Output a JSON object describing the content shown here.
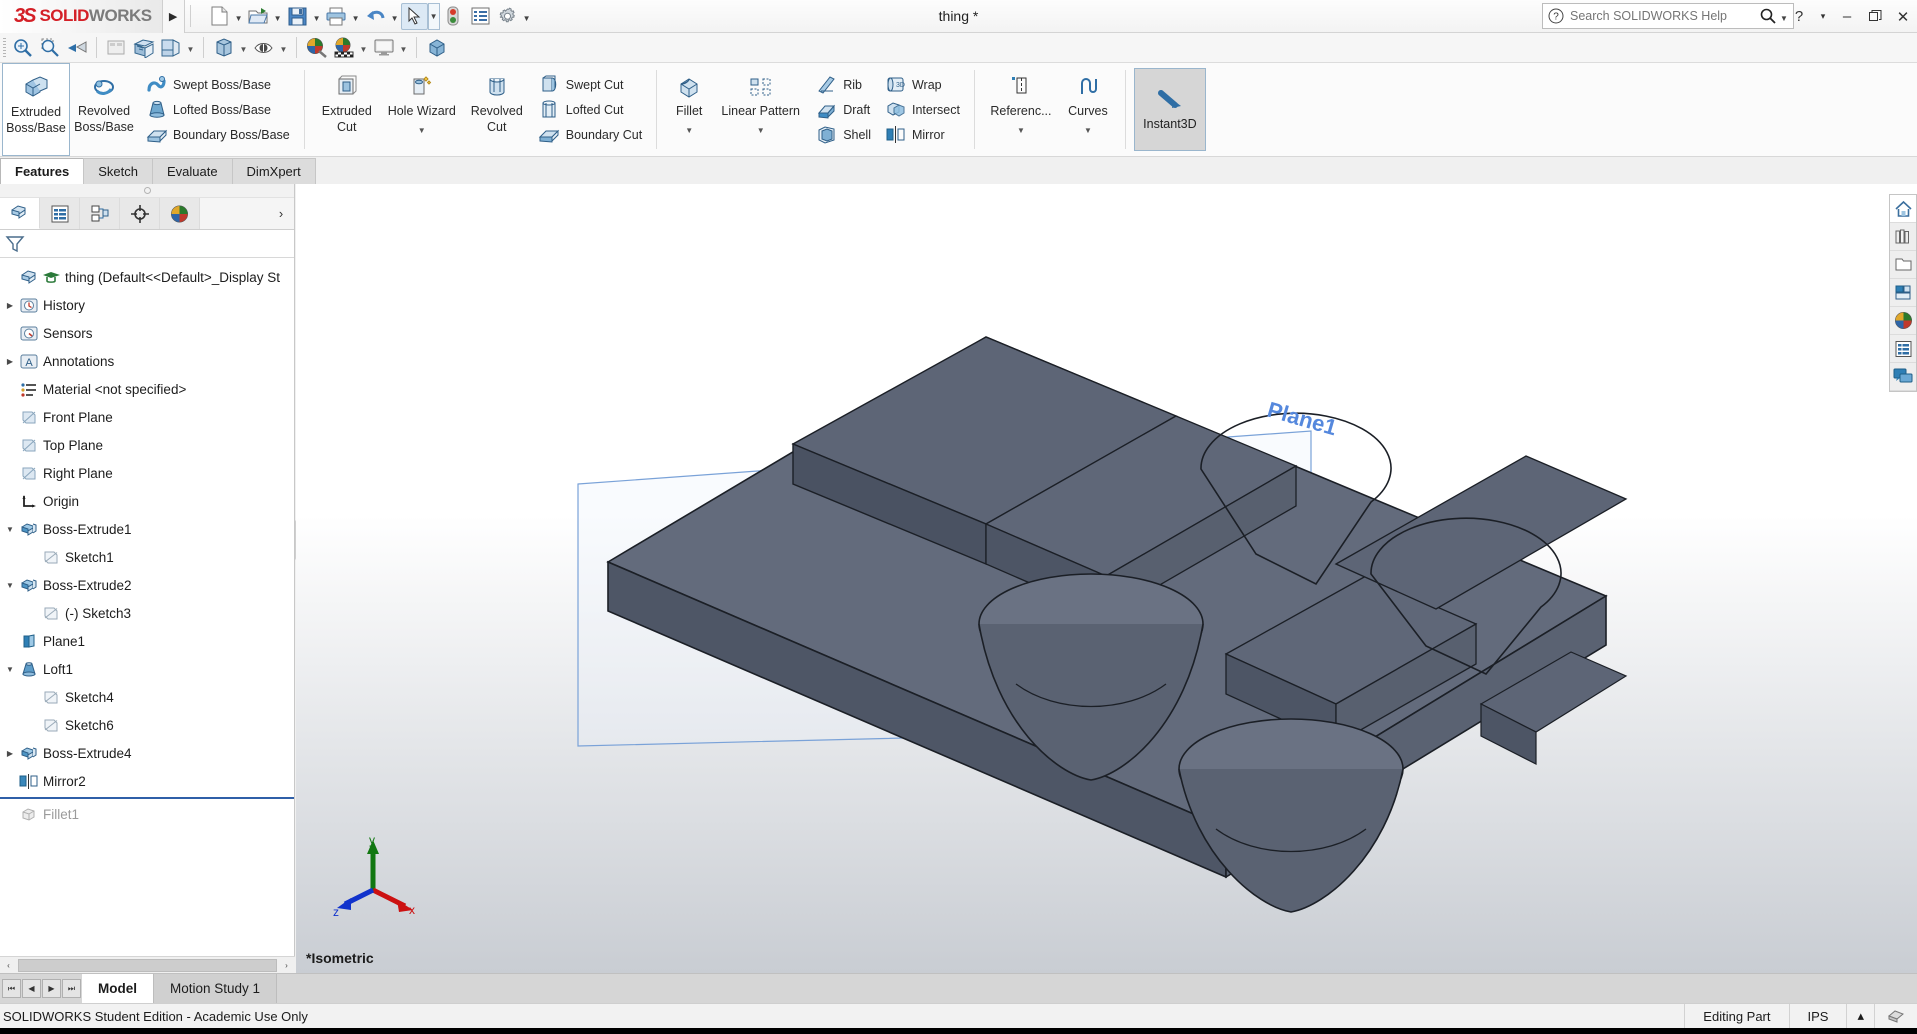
{
  "app": {
    "brand_ds": "3S",
    "brand_solid": "SOLID",
    "brand_works": "WORKS",
    "document_title": "thing *",
    "accent_red": "#d42027",
    "accent_blue": "#2f5fa8"
  },
  "search": {
    "placeholder": "Search SOLIDWORKS Help",
    "value": ""
  },
  "window_controls": {
    "help": "?",
    "help_caret": "▾",
    "minimize": "–",
    "restore": "❐",
    "close": "✕"
  },
  "standard_toolbar": {
    "items": [
      {
        "name": "new-document-icon",
        "caret": true
      },
      {
        "name": "open-document-icon",
        "caret": true
      },
      {
        "name": "save-icon",
        "caret": true
      },
      {
        "name": "print-icon",
        "caret": true
      },
      {
        "name": "undo-icon",
        "caret": true
      },
      {
        "name": "select-icon",
        "caret": true,
        "active": true
      },
      {
        "name": "rebuild-icon",
        "caret": false
      },
      {
        "name": "options-list-icon",
        "caret": false
      },
      {
        "name": "gear-options-icon",
        "caret": true
      }
    ]
  },
  "view_toolbar_top": {
    "items": [
      {
        "name": "zoom-to-fit-icon"
      },
      {
        "name": "zoom-to-area-icon"
      },
      {
        "name": "previous-view-icon"
      },
      {
        "name": "section-view-icon"
      },
      {
        "name": "view-orientation-icon",
        "caret": true
      },
      {
        "name": "display-style-icon",
        "caret": true
      },
      {
        "name": "hide-show-items-icon",
        "caret": true
      },
      {
        "name": "edit-appearance-icon"
      },
      {
        "name": "apply-scene-icon",
        "caret": true
      },
      {
        "name": "view-settings-icon"
      },
      {
        "name": "cube-icon"
      }
    ]
  },
  "ribbon": {
    "groups": [
      {
        "name": "boss-base-group",
        "big_buttons": [
          {
            "label_line1": "Extruded",
            "label_line2": "Boss/Base",
            "icon": "extruded-boss-icon",
            "framed": true
          },
          {
            "label_line1": "Revolved",
            "label_line2": "Boss/Base",
            "icon": "revolved-boss-icon",
            "framed": false
          }
        ],
        "stack": [
          {
            "label": "Swept Boss/Base",
            "icon": "swept-boss-icon"
          },
          {
            "label": "Lofted Boss/Base",
            "icon": "lofted-boss-icon"
          },
          {
            "label": "Boundary Boss/Base",
            "icon": "boundary-boss-icon"
          }
        ]
      },
      {
        "name": "cut-group",
        "big_buttons": [
          {
            "label_line1": "Extruded",
            "label_line2": "Cut",
            "icon": "extruded-cut-icon",
            "framed": false
          },
          {
            "label_line1": "Hole Wizard",
            "label_line2": "",
            "icon": "hole-wizard-icon",
            "framed": false,
            "caret": true
          },
          {
            "label_line1": "Revolved",
            "label_line2": "Cut",
            "icon": "revolved-cut-icon",
            "framed": false
          }
        ],
        "stack": [
          {
            "label": "Swept Cut",
            "icon": "swept-cut-icon"
          },
          {
            "label": "Lofted Cut",
            "icon": "lofted-cut-icon"
          },
          {
            "label": "Boundary Cut",
            "icon": "boundary-cut-icon"
          }
        ]
      },
      {
        "name": "features-group",
        "big_buttons": [
          {
            "label_line1": "Fillet",
            "label_line2": "",
            "icon": "fillet-icon",
            "framed": false,
            "caret": true
          },
          {
            "label_line1": "Linear Pattern",
            "label_line2": "",
            "icon": "linear-pattern-icon",
            "framed": false,
            "caret": true
          }
        ],
        "stack": [
          {
            "label": "Rib",
            "icon": "rib-icon"
          },
          {
            "label": "Draft",
            "icon": "draft-icon"
          },
          {
            "label": "Shell",
            "icon": "shell-icon"
          }
        ],
        "stack2": [
          {
            "label": "Wrap",
            "icon": "wrap-icon"
          },
          {
            "label": "Intersect",
            "icon": "intersect-icon"
          },
          {
            "label": "Mirror",
            "icon": "mirror-icon"
          }
        ]
      },
      {
        "name": "reference-group",
        "big_buttons": [
          {
            "label_line1": "Referenc...",
            "label_line2": "",
            "icon": "reference-geometry-icon",
            "framed": false,
            "caret": true
          },
          {
            "label_line1": "Curves",
            "label_line2": "",
            "icon": "curves-icon",
            "framed": false,
            "caret": true
          }
        ]
      }
    ],
    "instant3d": {
      "label": "Instant3D",
      "icon": "instant3d-icon",
      "active": true
    }
  },
  "command_tabs": [
    {
      "label": "Features",
      "active": true
    },
    {
      "label": "Sketch",
      "active": false
    },
    {
      "label": "Evaluate",
      "active": false
    },
    {
      "label": "DimXpert",
      "active": false
    }
  ],
  "panel_tabs": [
    {
      "name": "feature-manager-tab",
      "icon": "feature-tree-icon",
      "active": true
    },
    {
      "name": "property-manager-tab",
      "icon": "property-manager-icon",
      "active": false
    },
    {
      "name": "configuration-manager-tab",
      "icon": "configuration-manager-icon",
      "active": false
    },
    {
      "name": "dimxpert-manager-tab",
      "icon": "dimxpert-manager-icon",
      "active": false
    },
    {
      "name": "display-manager-tab",
      "icon": "display-manager-icon",
      "active": false
    }
  ],
  "panel_chevron": "›",
  "feature_tree": [
    {
      "label": "thing  (Default<<Default>_Display St",
      "icon": "part-icon",
      "indent": 0,
      "expand": "none",
      "greyed": false,
      "has_student_cap": true
    },
    {
      "label": "History",
      "icon": "history-icon",
      "indent": 0,
      "expand": "collapsed",
      "greyed": false
    },
    {
      "label": "Sensors",
      "icon": "sensors-icon",
      "indent": 0,
      "expand": "none",
      "greyed": false
    },
    {
      "label": "Annotations",
      "icon": "annotations-icon",
      "indent": 0,
      "expand": "collapsed",
      "greyed": false
    },
    {
      "label": "Material <not specified>",
      "icon": "material-icon",
      "indent": 0,
      "expand": "none",
      "greyed": false
    },
    {
      "label": "Front Plane",
      "icon": "plane-icon",
      "indent": 0,
      "expand": "none",
      "greyed": false
    },
    {
      "label": "Top Plane",
      "icon": "plane-icon",
      "indent": 0,
      "expand": "none",
      "greyed": false
    },
    {
      "label": "Right Plane",
      "icon": "plane-icon",
      "indent": 0,
      "expand": "none",
      "greyed": false
    },
    {
      "label": "Origin",
      "icon": "origin-icon",
      "indent": 0,
      "expand": "none",
      "greyed": false
    },
    {
      "label": "Boss-Extrude1",
      "icon": "boss-extrude-icon",
      "indent": 0,
      "expand": "expanded",
      "greyed": false
    },
    {
      "label": "Sketch1",
      "icon": "sketch-icon",
      "indent": 1,
      "expand": "none",
      "greyed": false
    },
    {
      "label": "Boss-Extrude2",
      "icon": "boss-extrude-icon",
      "indent": 0,
      "expand": "expanded",
      "greyed": false
    },
    {
      "label": "(-) Sketch3",
      "icon": "sketch-icon",
      "indent": 1,
      "expand": "none",
      "greyed": false
    },
    {
      "label": "Plane1",
      "icon": "plane1-icon",
      "indent": 0,
      "expand": "none",
      "greyed": false
    },
    {
      "label": "Loft1",
      "icon": "loft-icon",
      "indent": 0,
      "expand": "expanded",
      "greyed": false
    },
    {
      "label": "Sketch4",
      "icon": "sketch-icon",
      "indent": 1,
      "expand": "none",
      "greyed": false
    },
    {
      "label": "Sketch6",
      "icon": "sketch-icon",
      "indent": 1,
      "expand": "none",
      "greyed": false
    },
    {
      "label": "Boss-Extrude4",
      "icon": "boss-extrude-icon",
      "indent": 0,
      "expand": "collapsed",
      "greyed": false
    },
    {
      "label": "Mirror2",
      "icon": "mirror-feature-icon",
      "indent": 0,
      "expand": "none",
      "greyed": false
    },
    {
      "label": "Fillet1",
      "icon": "fillet-feature-icon",
      "indent": 0,
      "expand": "none",
      "greyed": true
    }
  ],
  "rollback_after_index": 18,
  "graphics": {
    "plane_label": "Plane1",
    "view_label": "*Isometric",
    "triad": {
      "x_label": "x",
      "y_label": "y",
      "z_label": "z",
      "x_color": "#cc1111",
      "y_color": "#117711",
      "z_color": "#1133cc"
    },
    "model_color": "#5a6272"
  },
  "right_dock": [
    {
      "name": "home-icon",
      "active": true
    },
    {
      "name": "design-library-icon",
      "active": false
    },
    {
      "name": "file-explorer-icon",
      "active": false
    },
    {
      "name": "view-palette-icon",
      "active": false
    },
    {
      "name": "appearances-icon",
      "active": false
    },
    {
      "name": "custom-properties-icon",
      "active": false
    },
    {
      "name": "sw-forum-icon",
      "active": false
    }
  ],
  "bottom": {
    "nav_first": "⏮",
    "nav_prev": "◀",
    "nav_next": "▶",
    "nav_last": "⏭",
    "tabs": [
      {
        "label": "Model",
        "active": true
      },
      {
        "label": "Motion Study 1",
        "active": false
      }
    ]
  },
  "status": {
    "left": "SOLIDWORKS Student Edition - Academic Use Only",
    "editing": "Editing Part",
    "units": "IPS",
    "units_caret": "▴"
  },
  "left_scroll": {
    "left_arrow": "‹",
    "right_arrow": "›"
  }
}
